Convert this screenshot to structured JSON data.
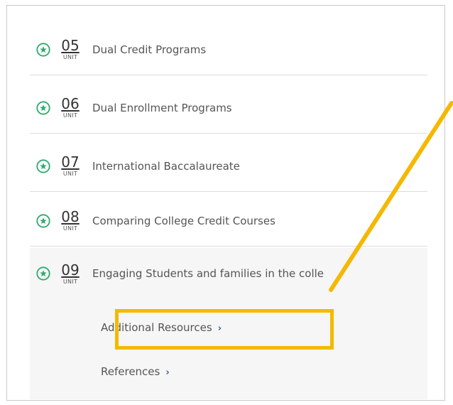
{
  "units": [
    {
      "number": "05",
      "unit_label": "UNIT",
      "title": "Dual Credit Programs"
    },
    {
      "number": "06",
      "unit_label": "UNIT",
      "title": "Dual Enrollment Programs"
    },
    {
      "number": "07",
      "unit_label": "UNIT",
      "title": "International Baccalaureate"
    },
    {
      "number": "08",
      "unit_label": "UNIT",
      "title": "Comparing College Credit Courses"
    },
    {
      "number": "09",
      "unit_label": "UNIT",
      "title": "Engaging Students and families in the colle"
    }
  ],
  "sub_links": [
    {
      "label": "Additional Resources",
      "chevron": "›"
    },
    {
      "label": "References",
      "chevron": "›"
    }
  ],
  "colors": {
    "icon_green": "#2eaa6e",
    "highlight": "#f5b800",
    "chevron": "#3a5a9a"
  },
  "icons": {
    "unit_status": "star-circle-icon"
  }
}
